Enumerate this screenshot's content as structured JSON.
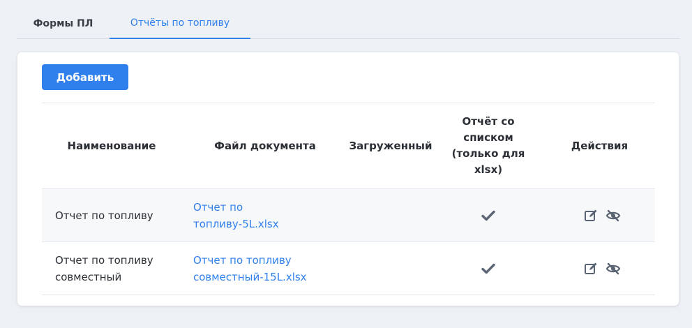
{
  "tabs": [
    {
      "label": "Формы ПЛ",
      "active": false
    },
    {
      "label": "Отчёты по топливу",
      "active": true
    }
  ],
  "toolbar": {
    "add_label": "Добавить"
  },
  "table": {
    "headers": [
      "Наименование",
      "Файл документа",
      "Загруженный",
      "Отчёт со списком (только для xlsx)",
      "Действия"
    ],
    "rows": [
      {
        "name": "Отчет по топливу",
        "file": "Отчет по топливу-5L.xlsx",
        "uploaded": "",
        "list_report": "check-icon",
        "actions": [
          "edit-icon",
          "hide-icon"
        ]
      },
      {
        "name": "Отчет по топливу совместный",
        "file": "Отчет по топливу совместный-15L.xlsx",
        "uploaded": "",
        "list_report": "check-icon",
        "actions": [
          "edit-icon",
          "hide-icon"
        ]
      }
    ]
  },
  "colors": {
    "accent": "#2f80ed",
    "icon": "#5b6472",
    "background": "#edf0f5"
  }
}
